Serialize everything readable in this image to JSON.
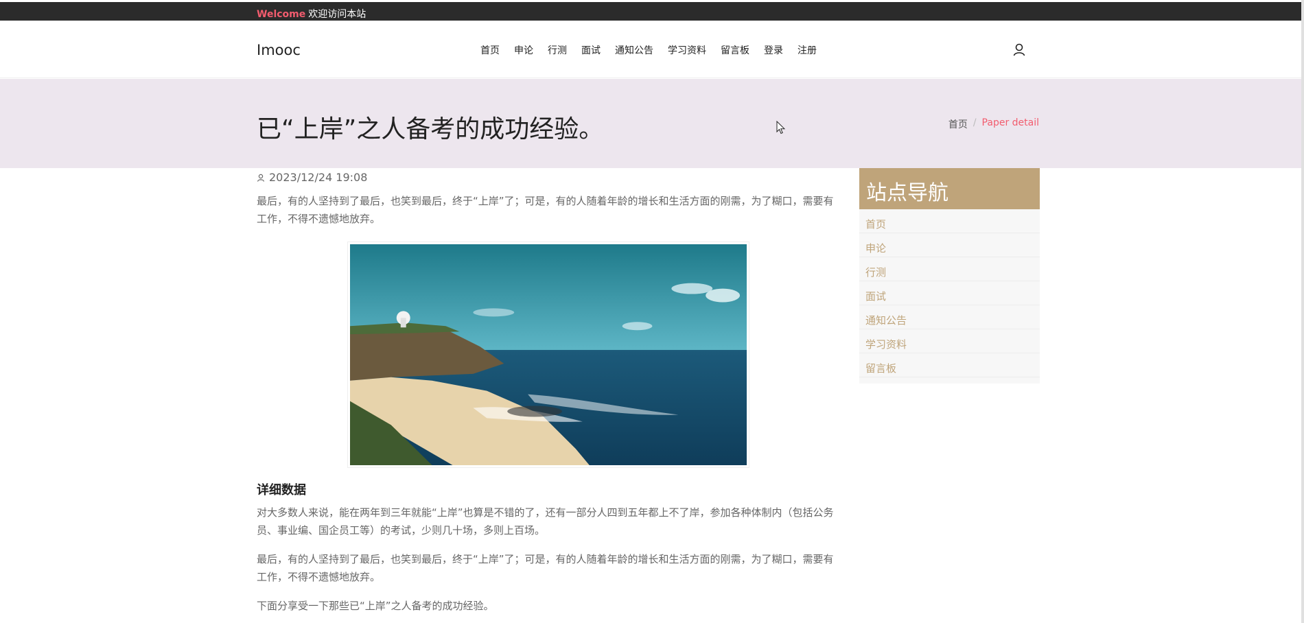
{
  "topbar": {
    "welcome": "Welcome",
    "text": "欢迎访问本站"
  },
  "header": {
    "logo": "Imooc",
    "nav": [
      "首页",
      "申论",
      "行测",
      "面试",
      "通知公告",
      "学习资料",
      "留言板",
      "登录",
      "注册"
    ],
    "user_icon": "user-icon"
  },
  "banner": {
    "title": "已“上岸”之人备考的成功经验。",
    "breadcrumb": {
      "home": "首页",
      "sep": "/",
      "current": "Paper detail"
    }
  },
  "article": {
    "date": "2023/12/24 19:08",
    "para1": "最后，有的人坚持到了最后，也笑到最后，终于“上岸”了；可是，有的人随着年龄的增长和生活方面的刚需，为了糊口，需要有工作，不得不遗憾地放弃。",
    "image": "coastal-cliff-sea-photo",
    "subheading": "详细数据",
    "para2": "对大多数人来说，能在两年到三年就能“上岸”也算是不错的了，还有一部分人四到五年都上不了岸，参加各种体制内（包括公务员、事业编、国企员工等）的考试，少则几十场，多则上百场。",
    "para3": "最后，有的人坚持到了最后，也笑到最后，终于“上岸”了；可是，有的人随着年龄的增长和生活方面的刚需，为了糊口，需要有工作，不得不遗憾地放弃。",
    "para4": "下面分享受一下那些已“上岸”之人备考的成功经验。"
  },
  "sidebar": {
    "title": "站点导航",
    "items": [
      "首页",
      "申论",
      "行测",
      "面试",
      "通知公告",
      "学习资料",
      "留言板"
    ]
  },
  "colors": {
    "accent": "#f25c6e",
    "sidebar": "#bfa47a",
    "banner": "#ede6ee"
  }
}
